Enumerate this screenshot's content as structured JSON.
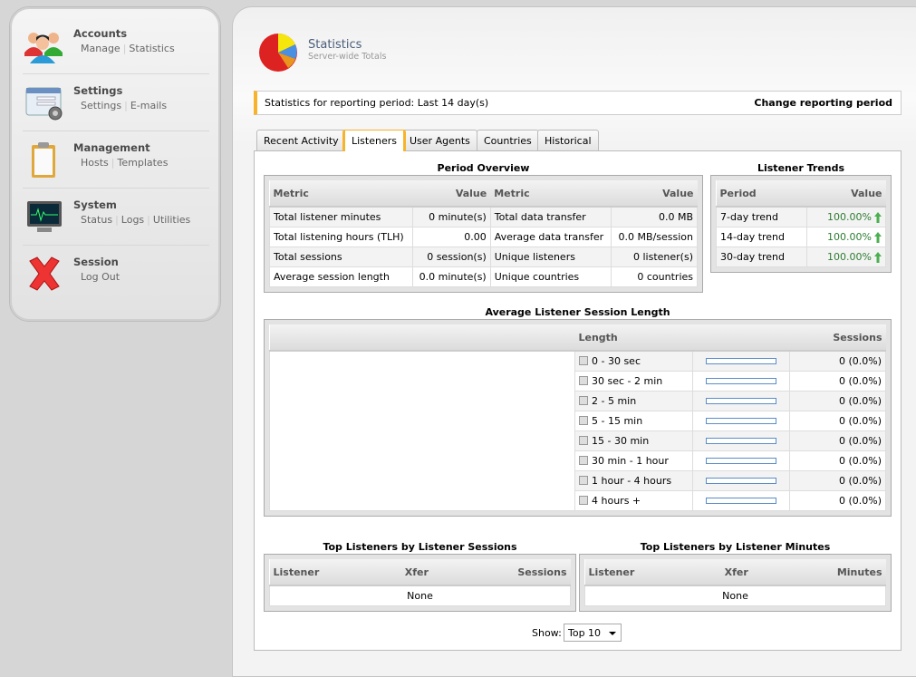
{
  "sidebar": {
    "sections": [
      {
        "title": "Accounts",
        "icon": "users-icon",
        "links": [
          "Manage",
          "Statistics"
        ]
      },
      {
        "title": "Settings",
        "icon": "settings-form-icon",
        "links": [
          "Settings",
          "E-mails"
        ]
      },
      {
        "title": "Management",
        "icon": "clipboard-icon",
        "links": [
          "Hosts",
          "Templates"
        ]
      },
      {
        "title": "System",
        "icon": "monitor-icon",
        "links": [
          "Status",
          "Logs",
          "Utilities"
        ]
      },
      {
        "title": "Session",
        "icon": "red-x-icon",
        "links": [
          "Log Out"
        ]
      }
    ]
  },
  "header": {
    "title": "Statistics",
    "subtitle": "Server-wide Totals",
    "icon": "pie-chart-icon"
  },
  "period": {
    "text": "Statistics for reporting period: Last 14 day(s)",
    "change_label": "Change reporting period"
  },
  "tabs": [
    {
      "label": "Recent Activity",
      "active": false
    },
    {
      "label": "Listeners",
      "active": true
    },
    {
      "label": "User Agents",
      "active": false
    },
    {
      "label": "Countries",
      "active": false
    },
    {
      "label": "Historical",
      "active": false
    }
  ],
  "overview": {
    "title": "Period Overview",
    "headers": [
      "Metric",
      "Value",
      "Metric",
      "Value"
    ],
    "rows": [
      [
        "Total listener minutes",
        "0 minute(s)",
        "Total data transfer",
        "0.0 MB"
      ],
      [
        "Total listening hours (TLH)",
        "0.00",
        "Average data transfer",
        "0.0 MB/session"
      ],
      [
        "Total sessions",
        "0 session(s)",
        "Unique listeners",
        "0 listener(s)"
      ],
      [
        "Average session length",
        "0.0 minute(s)",
        "Unique countries",
        "0 countries"
      ]
    ]
  },
  "trends": {
    "title": "Listener Trends",
    "headers": [
      "Period",
      "Value"
    ],
    "rows": [
      {
        "period": "7-day trend",
        "value": "100.00%",
        "icon": "arrow-up-icon"
      },
      {
        "period": "14-day trend",
        "value": "100.00%",
        "icon": "arrow-up-icon"
      },
      {
        "period": "30-day trend",
        "value": "100.00%",
        "icon": "arrow-up-icon"
      }
    ],
    "color": "#2e7d32"
  },
  "session_length": {
    "title": "Average Listener Session Length",
    "headers": [
      "Length",
      "Sessions"
    ],
    "rows": [
      {
        "label": "0 - 30 sec",
        "sessions": "0 (0.0%)",
        "percent": 0
      },
      {
        "label": "30 sec - 2 min",
        "sessions": "0 (0.0%)",
        "percent": 0
      },
      {
        "label": "2 - 5 min",
        "sessions": "0 (0.0%)",
        "percent": 0
      },
      {
        "label": "5 - 15 min",
        "sessions": "0 (0.0%)",
        "percent": 0
      },
      {
        "label": "15 - 30 min",
        "sessions": "0 (0.0%)",
        "percent": 0
      },
      {
        "label": "30 min - 1 hour",
        "sessions": "0 (0.0%)",
        "percent": 0
      },
      {
        "label": "1 hour - 4 hours",
        "sessions": "0 (0.0%)",
        "percent": 0
      },
      {
        "label": "4 hours +",
        "sessions": "0 (0.0%)",
        "percent": 0
      }
    ]
  },
  "top_sessions": {
    "title": "Top Listeners by Listener Sessions",
    "headers": [
      "Listener",
      "Xfer",
      "Sessions"
    ],
    "empty": "None"
  },
  "top_minutes": {
    "title": "Top Listeners by Listener Minutes",
    "headers": [
      "Listener",
      "Xfer",
      "Minutes"
    ],
    "empty": "None"
  },
  "show": {
    "label": "Show:",
    "value": "Top 10"
  },
  "colors": {
    "accent": "#f7b32b",
    "bar": "#5b8dc9"
  }
}
